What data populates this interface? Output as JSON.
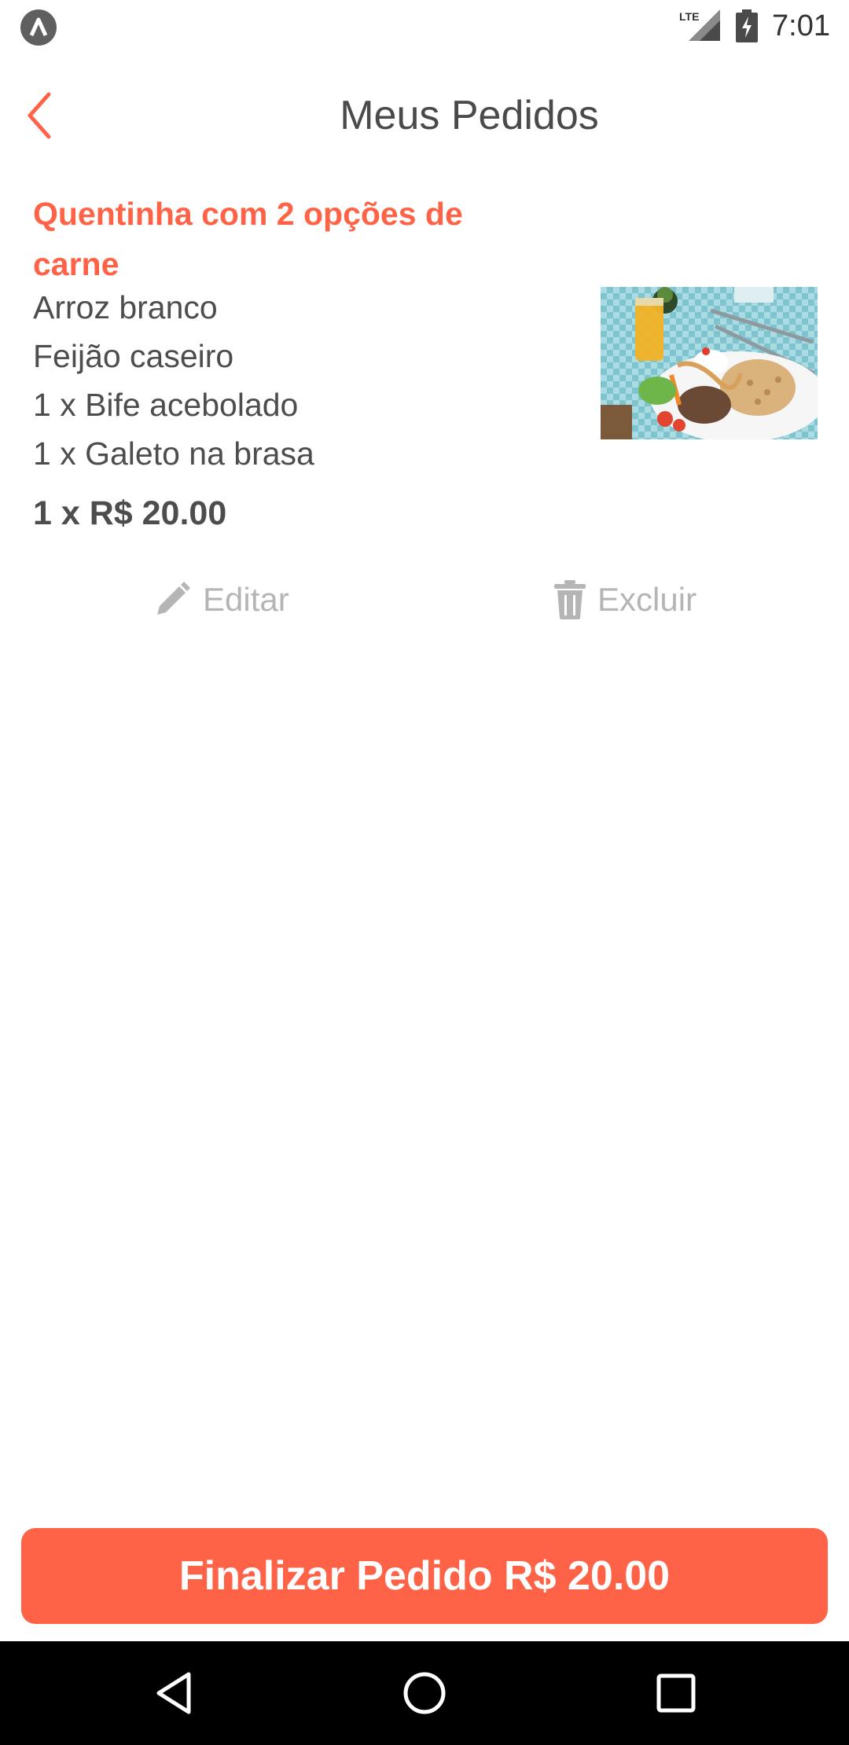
{
  "status_bar": {
    "network": "LTE",
    "time": "7:01"
  },
  "header": {
    "title": "Meus Pedidos",
    "back_icon": "chevron-left-icon"
  },
  "order_items": [
    {
      "name": "Quentinha com 2 opções de carne",
      "options": [
        "Arroz branco",
        "Feijão caseiro",
        "1 x Bife acebolado",
        "1 x Galeto na brasa"
      ],
      "price_line": "1 x R$ 20.00",
      "edit_label": "Editar",
      "delete_label": "Excluir"
    }
  ],
  "checkout": {
    "label": "Finalizar Pedido R$ 20.00"
  },
  "colors": {
    "accent": "#ff6347",
    "text": "#4d4d4d",
    "muted": "#b5b5b5"
  }
}
